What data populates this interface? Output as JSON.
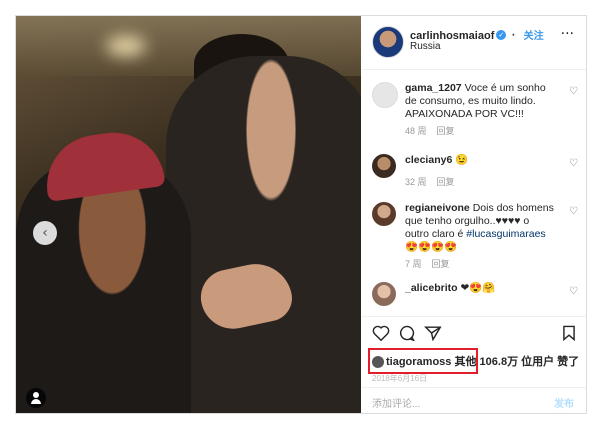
{
  "post": {
    "author": "carlinhosmaiaof",
    "follow_label": "关注",
    "location": "Russia",
    "more_glyph": "···"
  },
  "comments": [
    {
      "user": "gama_1207",
      "text": "Voce é um sonho de consumo, es muito lindo. APAIXONADA POR VC!!!",
      "time": "48 周",
      "reply": "回复"
    },
    {
      "user": "cleciany6",
      "text": "😉",
      "time": "32 周",
      "reply": "回复"
    },
    {
      "user": "regianeivone",
      "text": "Dois dos homens que tenho orgulho..♥♥♥♥ o outro claro é",
      "hashtag": "#lucasguimaraes",
      "emoji": "😍😍😍😍",
      "time": "7 周",
      "reply": "回复"
    },
    {
      "user": "_alicebrito",
      "text": "❤😍🤗",
      "time": "",
      "reply": ""
    }
  ],
  "likes": {
    "liker": "tiagoramoss",
    "others_text": "其他 106.8万 位用户 赞了"
  },
  "time_label": "2018年6月16日",
  "add_comment": {
    "placeholder": "添加评论...",
    "post_label": "发布"
  },
  "icons": [
    "heart-icon",
    "comment-icon",
    "share-icon",
    "bookmark-icon",
    "verified-icon",
    "more-icon",
    "prev-arrow-icon",
    "tag-user-icon"
  ],
  "colors": {
    "accent": "#3897f0",
    "highlight": "#e21e2a",
    "hashtag": "#003569"
  }
}
